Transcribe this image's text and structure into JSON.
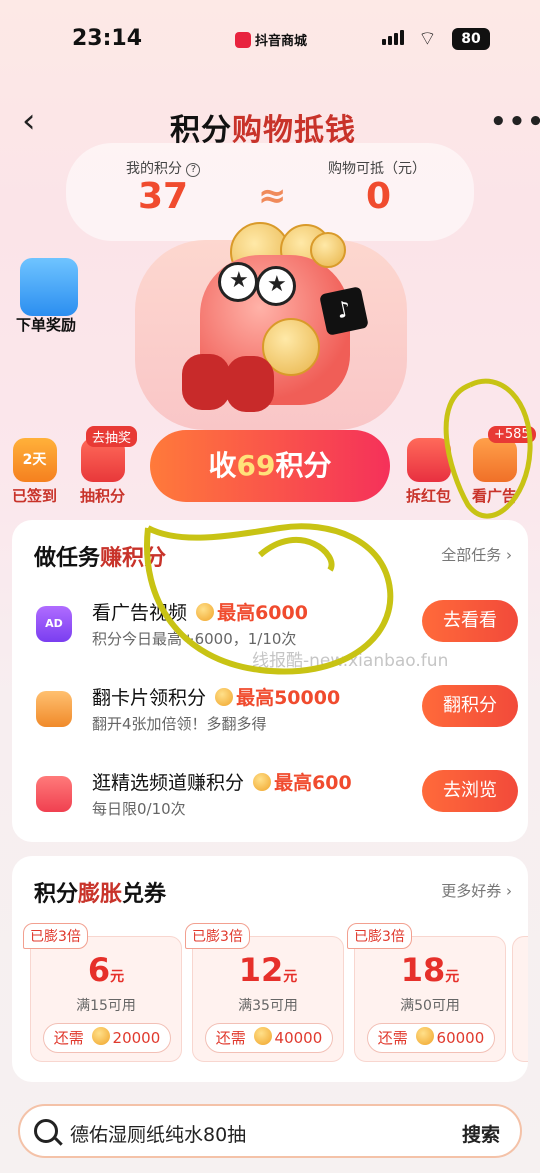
{
  "status_bar": {
    "time": "23:14",
    "app_name": "抖音商城",
    "battery": "80"
  },
  "nav": {
    "title_a": "积分",
    "title_b": "购物抵钱"
  },
  "points": {
    "my_points_label": "我的积分",
    "my_points_value": "37",
    "approx": "≈",
    "deduct_label": "购物可抵（元）",
    "deduct_value": "0"
  },
  "side_items": {
    "order_reward": "下单奖励",
    "signed": {
      "icon_text": "2天",
      "label": "已签到"
    },
    "lottery": {
      "badge": "去抽奖",
      "label": "抽积分"
    },
    "red_packet": {
      "label": "拆红包"
    },
    "watch_ad": {
      "badge": "+585",
      "label": "看广告"
    }
  },
  "collect_button": {
    "prefix": "收",
    "number": "69",
    "suffix": "积分"
  },
  "tasks": {
    "title_a": "做任务",
    "title_b": "赚积分",
    "all_link": "全部任务 ›",
    "items": [
      {
        "name": "看广告视频",
        "max": "最高6000",
        "sub": "积分今日最高+6000，1/10次",
        "button": "去看看",
        "icon": "ad-icon"
      },
      {
        "name": "翻卡片领积分",
        "max": "最高50000",
        "sub": "翻开4张加倍领！多翻多得",
        "button": "翻积分",
        "icon": "cards-icon"
      },
      {
        "name": "逛精选频道赚积分",
        "max": "最高600",
        "sub": "每日限0/10次",
        "button": "去浏览",
        "icon": "shopping-bag-icon"
      }
    ]
  },
  "watermark": "线报酷-new.xianbao.fun",
  "coupons": {
    "title_a": "积分",
    "title_b": "膨胀",
    "title_c": "兑券",
    "more_link": "更多好券 ›",
    "items": [
      {
        "tag": "已膨3倍",
        "amount": "6",
        "unit": "元",
        "cond": "满15可用",
        "need_label": "还需",
        "need": "20000"
      },
      {
        "tag": "已膨3倍",
        "amount": "12",
        "unit": "元",
        "cond": "满35可用",
        "need_label": "还需",
        "need": "40000"
      },
      {
        "tag": "已膨3倍",
        "amount": "18",
        "unit": "元",
        "cond": "满50可用",
        "need_label": "还需",
        "need": "60000"
      }
    ]
  },
  "search": {
    "query": "德佑湿厕纸纯水80抽",
    "button": "搜索"
  },
  "colors": {
    "accent": "#f04b2e",
    "brand_red": "#c8332a",
    "annotation": "#c8c314"
  }
}
